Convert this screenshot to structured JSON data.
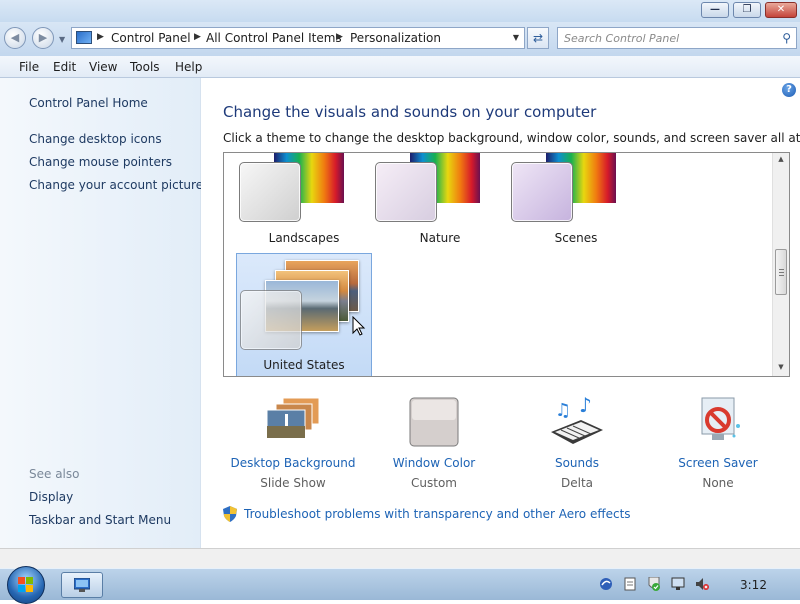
{
  "window": {
    "min_icon": "minimize-icon",
    "max_icon": "maximize-icon",
    "close_icon": "close-icon"
  },
  "nav": {
    "breadcrumbs": [
      "Control Panel",
      "All Control Panel Items",
      "Personalization"
    ],
    "search_placeholder": "Search Control Panel"
  },
  "menu": {
    "file": "File",
    "edit": "Edit",
    "view": "View",
    "tools": "Tools",
    "help": "Help"
  },
  "sidebar": {
    "home": "Control Panel Home",
    "links": [
      "Change desktop icons",
      "Change mouse pointers",
      "Change your account picture"
    ],
    "see_also_label": "See also",
    "see_also": [
      "Display",
      "Taskbar and Start Menu"
    ]
  },
  "main": {
    "heading": "Change the visuals and sounds on your computer",
    "subtext": "Click a theme to change the desktop background, window color, sounds, and screen saver all at once.",
    "themes": [
      {
        "name": "Landscapes",
        "selected": false
      },
      {
        "name": "Nature",
        "selected": false
      },
      {
        "name": "Scenes",
        "selected": false
      },
      {
        "name": "United States",
        "selected": true
      }
    ],
    "settings": [
      {
        "label": "Desktop Background",
        "value": "Slide Show",
        "icon": "desktop-background-icon"
      },
      {
        "label": "Window Color",
        "value": "Custom",
        "icon": "window-color-icon"
      },
      {
        "label": "Sounds",
        "value": "Delta",
        "icon": "sounds-icon"
      },
      {
        "label": "Screen Saver",
        "value": "None",
        "icon": "screen-saver-icon"
      }
    ],
    "troubleshoot": "Troubleshoot problems with transparency and other Aero effects"
  },
  "taskbar": {
    "clock": "3:12"
  },
  "colors": {
    "link": "#1d63b5",
    "heading": "#1e3a7a",
    "selection": "#c3daf6"
  }
}
